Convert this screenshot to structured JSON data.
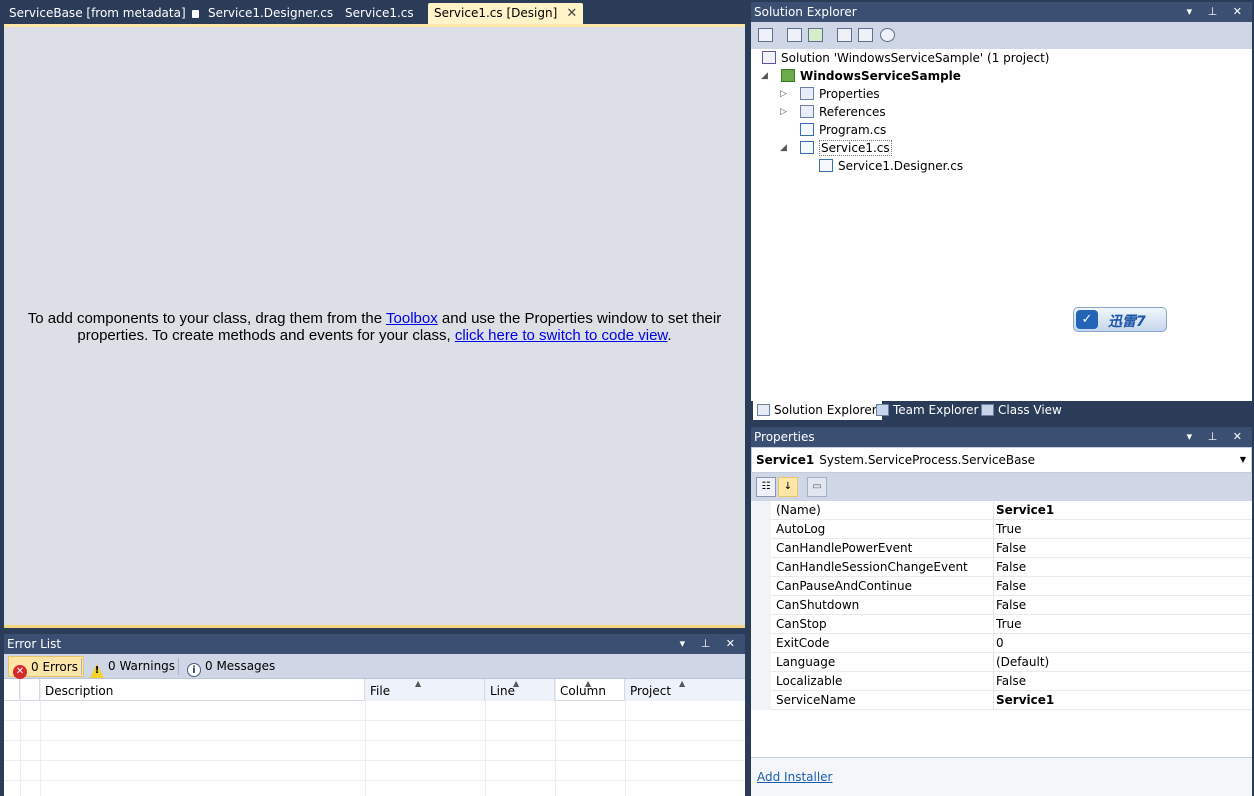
{
  "doc_tabs": [
    {
      "label": "ServiceBase [from metadata]",
      "active": false
    },
    {
      "label": "Service1.Designer.cs",
      "active": false
    },
    {
      "label": "Service1.cs",
      "active": false
    },
    {
      "label": "Service1.cs [Design]",
      "active": true
    }
  ],
  "designer": {
    "line1_a": "To add components to your class, drag them from the ",
    "line1_link": "Toolbox",
    "line1_b": " and use the Properties window to set their",
    "line2_a": "properties. To create methods and events for your class, ",
    "line2_link": "click here to switch to code view",
    "line2_b": "."
  },
  "error_list": {
    "title": "Error List",
    "errors": "0 Errors",
    "warnings": "0 Warnings",
    "messages": "0 Messages",
    "columns": [
      "Description",
      "File",
      "Line",
      "Column",
      "Project"
    ]
  },
  "solution_explorer": {
    "title": "Solution Explorer",
    "solution": "Solution 'WindowsServiceSample' (1 project)",
    "project": "WindowsServiceSample",
    "items": [
      "Properties",
      "References",
      "Program.cs",
      "Service1.cs"
    ],
    "child": "Service1.Designer.cs",
    "badge": "迅雷7",
    "tabs": [
      "Solution Explorer",
      "Team Explorer",
      "Class View"
    ]
  },
  "properties": {
    "title": "Properties",
    "object_name": "Service1",
    "object_type": "System.ServiceProcess.ServiceBase",
    "rows": [
      {
        "name": "(Name)",
        "value": "Service1",
        "bold": true
      },
      {
        "name": "AutoLog",
        "value": "True",
        "bold": false
      },
      {
        "name": "CanHandlePowerEvent",
        "value": "False",
        "bold": false
      },
      {
        "name": "CanHandleSessionChangeEvent",
        "value": "False",
        "bold": false
      },
      {
        "name": "CanPauseAndContinue",
        "value": "False",
        "bold": false
      },
      {
        "name": "CanShutdown",
        "value": "False",
        "bold": false
      },
      {
        "name": "CanStop",
        "value": "True",
        "bold": false
      },
      {
        "name": "ExitCode",
        "value": "0",
        "bold": false
      },
      {
        "name": "Language",
        "value": "(Default)",
        "bold": false
      },
      {
        "name": "Localizable",
        "value": "False",
        "bold": false
      },
      {
        "name": "ServiceName",
        "value": "Service1",
        "bold": true
      }
    ],
    "command": "Add Installer"
  },
  "colors": {
    "chrome": "#2b3c59",
    "active_tab": "#fff3c8",
    "designer_bg": "#dddfe6"
  }
}
